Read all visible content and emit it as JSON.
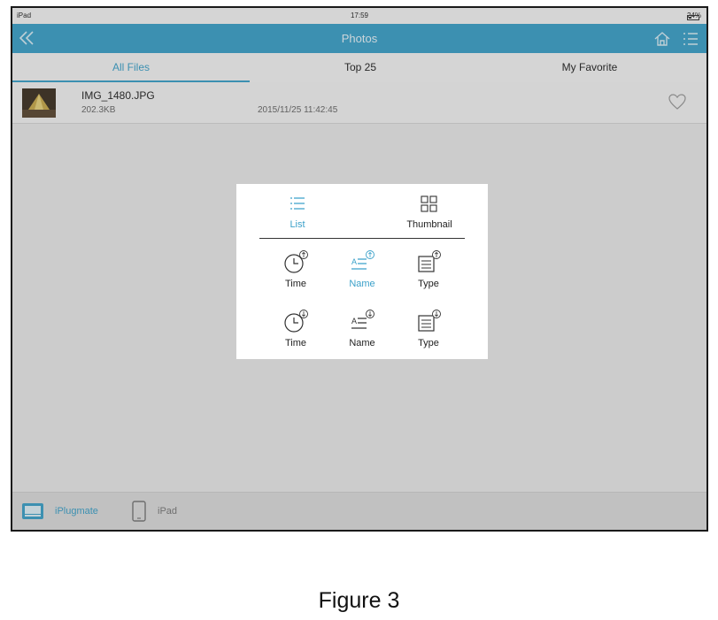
{
  "status_bar": {
    "device": "iPad",
    "time": "17:59",
    "battery": "24%"
  },
  "nav": {
    "title": "Photos"
  },
  "tabs": [
    {
      "label": "All Files",
      "active": true
    },
    {
      "label": "Top 25",
      "active": false
    },
    {
      "label": "My Favorite",
      "active": false
    }
  ],
  "file": {
    "name": "IMG_1480.JPG",
    "size": "202.3KB",
    "date": "2015/11/25 11:42:45"
  },
  "view_options": {
    "list": "List",
    "thumbnail": "Thumbnail"
  },
  "sort_ascending": {
    "time": "Time",
    "name": "Name",
    "type": "Type"
  },
  "sort_descending": {
    "time": "Time",
    "name": "Name",
    "type": "Type"
  },
  "bottom_bar": {
    "source1": "iPlugmate",
    "source2": "iPad"
  },
  "caption": "Figure 3",
  "colors": {
    "accent": "#3aa0c9",
    "navbar": "#3aa0c9"
  }
}
